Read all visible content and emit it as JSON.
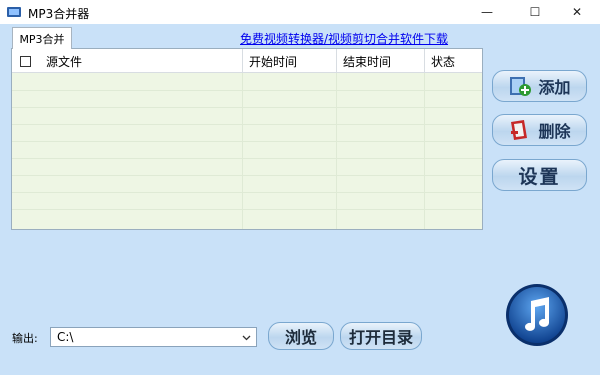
{
  "window": {
    "title": "MP3合并器",
    "minimize_glyph": "—",
    "maximize_glyph": "☐",
    "close_glyph": "✕"
  },
  "tab": {
    "label": "MP3合并"
  },
  "top_link": {
    "text": "免费视频转换器/视频剪切合并软件下载"
  },
  "table": {
    "columns": [
      "源文件",
      "开始时间",
      "结束时间",
      "状态"
    ],
    "rows": []
  },
  "side_buttons": {
    "add": "添加",
    "delete": "删除",
    "settings": "设置"
  },
  "output": {
    "label": "输出:",
    "path": "C:\\"
  },
  "bottom_buttons": {
    "browse": "浏览",
    "open_dir": "打开目录"
  },
  "icons": {
    "app": "app-icon",
    "add": "add-file-icon",
    "delete": "delete-file-icon",
    "logo": "music-note-icon",
    "dropdown": "chevron-down-icon"
  },
  "colors": {
    "background": "#c9e1f8",
    "grid_bg": "#eef6e4",
    "link": "#0000ee",
    "logo_blue": "#1257b4"
  }
}
